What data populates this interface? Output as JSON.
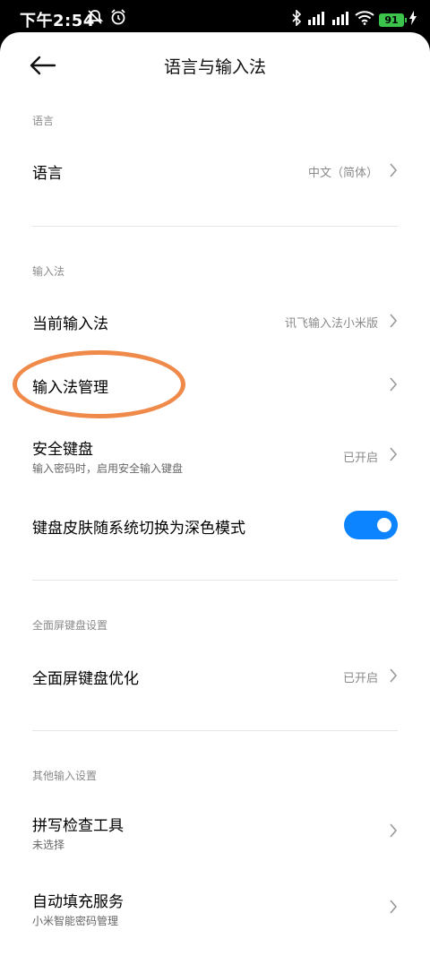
{
  "status_bar": {
    "time": "下午2:54",
    "battery": "91",
    "icons": [
      "mute-icon",
      "alarm-icon",
      "bluetooth-icon",
      "signal-icon",
      "signal-icon",
      "wifi-icon",
      "battery-icon",
      "charging-icon"
    ]
  },
  "header": {
    "title": "语言与输入法"
  },
  "sections": {
    "language": {
      "label": "语言",
      "row": {
        "title": "语言",
        "value": "中文（简体）"
      }
    },
    "input_method": {
      "label": "输入法",
      "current": {
        "title": "当前输入法",
        "value": "讯飞输入法小米版"
      },
      "manage": {
        "title": "输入法管理"
      },
      "secure_keyboard": {
        "title": "安全键盘",
        "subtitle": "输入密码时，启用安全输入键盘",
        "value": "已开启"
      },
      "dark_skin": {
        "title": "键盘皮肤随系统切换为深色模式",
        "enabled": true
      }
    },
    "fullscreen": {
      "label": "全面屏键盘设置",
      "optimize": {
        "title": "全面屏键盘优化",
        "value": "已开启"
      }
    },
    "other": {
      "label": "其他输入设置",
      "spell_check": {
        "title": "拼写检查工具",
        "subtitle": "未选择"
      },
      "autofill": {
        "title": "自动填充服务",
        "subtitle": "小米智能密码管理"
      }
    }
  },
  "colors": {
    "accent": "#0d84ff",
    "highlight": "#f08a4b",
    "battery": "#3cc34c"
  }
}
